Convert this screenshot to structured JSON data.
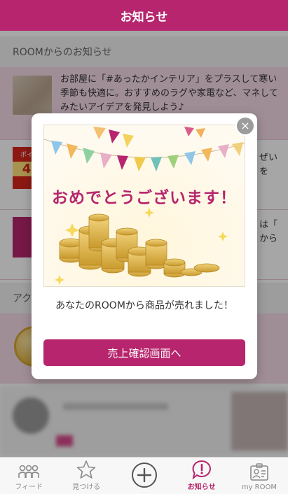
{
  "header": {
    "title": "お知らせ"
  },
  "sections": {
    "room_notices": "ROOMからのお知らせ",
    "activity": "アク"
  },
  "notices": [
    {
      "text": "お部屋に「#あったかインテリア」をプラスして寒い季節も快適に。おすすめのラグや家電など、マネしてみたいアイデアを発見しよう♪"
    },
    {
      "thumb_text": "ポイ",
      "thumb_number": "4",
      "partial_text_1": "ぜい",
      "partial_text_2": "を"
    },
    {
      "partial_text_1": "は「",
      "partial_text_2": "から"
    }
  ],
  "modal": {
    "close_label": "×",
    "congrats_title": "おめでとうございます！",
    "message": "あなたのROOMから商品が売れました！",
    "button_label": "売上確認画面へ"
  },
  "tabbar": {
    "items": [
      {
        "label": "フィード",
        "icon": "people-icon"
      },
      {
        "label": "見つける",
        "icon": "star-icon"
      },
      {
        "label": "",
        "icon": "plus-circle-icon"
      },
      {
        "label": "お知らせ",
        "icon": "notification-icon"
      },
      {
        "label": "my ROOM",
        "icon": "profile-card-icon"
      }
    ]
  },
  "colors": {
    "brand": "#b6256d",
    "notice_bg": "#f6dbe6"
  }
}
